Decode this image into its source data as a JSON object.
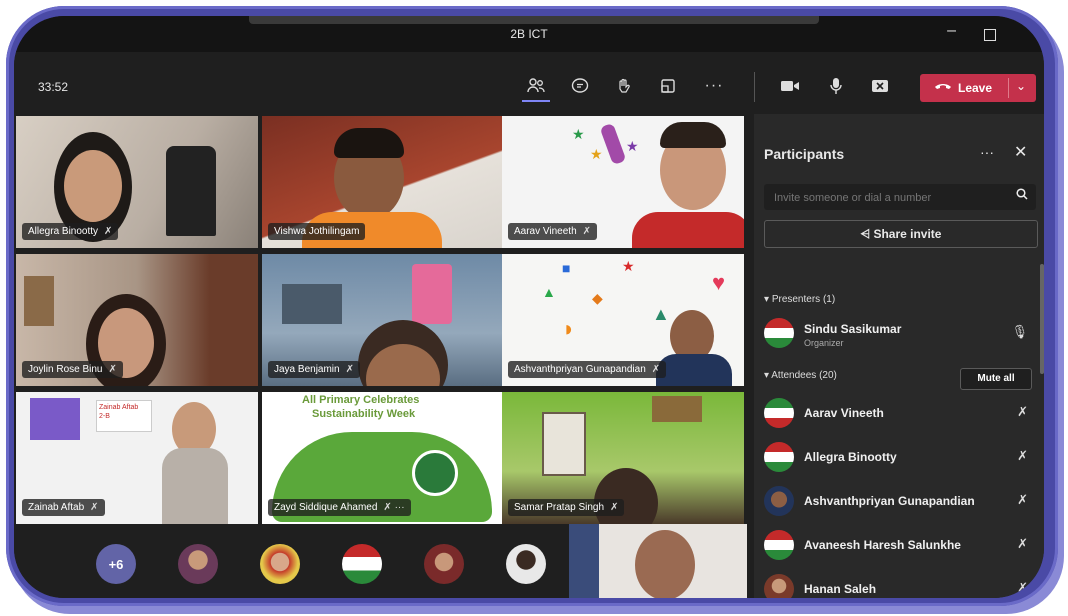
{
  "window": {
    "title": "2B ICT"
  },
  "toolbar": {
    "timer": "33:52",
    "leave_label": "Leave"
  },
  "tiles": [
    {
      "name": "Allegra Binootty"
    },
    {
      "name": "Vishwa Jothilingam"
    },
    {
      "name": "Aarav Vineeth"
    },
    {
      "name": "Joylin Rose Binu"
    },
    {
      "name": "Jaya Benjamin"
    },
    {
      "name": "Ashvanthpriyan Gunapandian"
    },
    {
      "name": "Zainab Aftab"
    },
    {
      "name": "Zayd Siddique Ahamed"
    },
    {
      "name": "Samar Pratap Singh"
    }
  ],
  "tile_text": {
    "primary_banner": "All Primary Celebrates",
    "sustainability": "Sustainability Week",
    "zainab_card": "Zainab Aftab",
    "zainab_class": "2-B"
  },
  "bottom": {
    "more_count": "+6"
  },
  "panel": {
    "title": "Participants",
    "invite_placeholder": "Invite someone or dial a number",
    "share_label": "Share invite",
    "presenters_header": "Presenters (1)",
    "attendees_header": "Attendees (20)",
    "mute_all": "Mute all",
    "presenter": {
      "name": "Sindu Sasikumar",
      "role": "Organizer"
    },
    "attendees": [
      {
        "name": "Aarav Vineeth"
      },
      {
        "name": "Allegra Binootty"
      },
      {
        "name": "Ashvanthpriyan Gunapandian"
      },
      {
        "name": "Avaneesh Haresh Salunkhe"
      },
      {
        "name": "Hanan Saleh"
      }
    ]
  },
  "colors": {
    "accent": "#6264a7",
    "leave": "#c4314b",
    "frame": "#4a4aa6"
  }
}
